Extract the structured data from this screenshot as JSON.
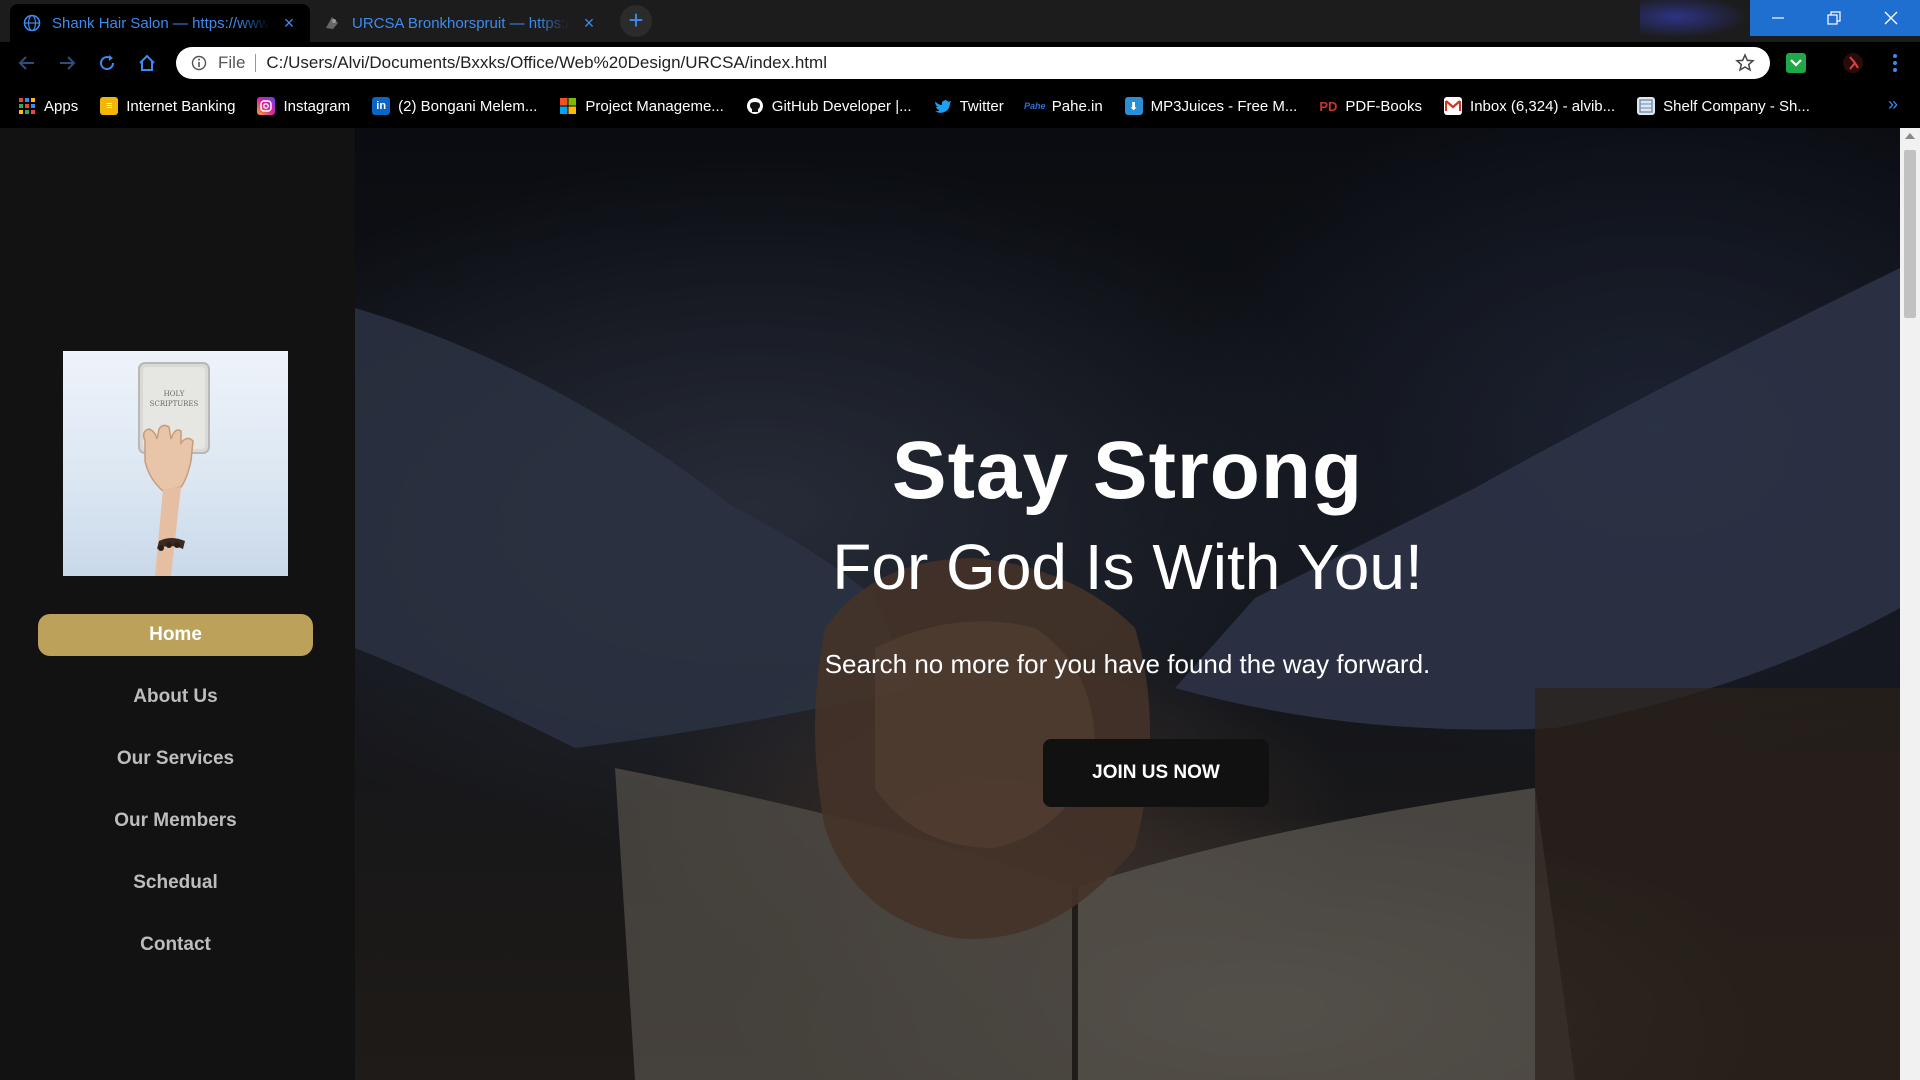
{
  "browser": {
    "tabs": [
      {
        "title": "Shank Hair Salon — https://www.shankhairsalon.co.za",
        "active": true
      },
      {
        "title": "URCSA Bronkhorspruit — https://",
        "active": false
      }
    ],
    "address": {
      "scheme": "File",
      "url": "C:/Users/Alvi/Documents/Bxxks/Office/Web%20Design/URCSA/index.html"
    },
    "bookmarks": [
      {
        "label": "Apps",
        "icon": "apps-grid-icon",
        "color": "#e8453c"
      },
      {
        "label": "Internet Banking",
        "icon": "bank-icon",
        "color": "#f2b705"
      },
      {
        "label": "Instagram",
        "icon": "instagram-icon",
        "color": "#d6249f"
      },
      {
        "label": "(2) Bongani Melem...",
        "icon": "linkedin-icon",
        "color": "#0a66c2"
      },
      {
        "label": "Project Manageme...",
        "icon": "microsoft-icon",
        "color": "#f25022"
      },
      {
        "label": "GitHub Developer |...",
        "icon": "github-icon",
        "color": "#333333"
      },
      {
        "label": "Twitter",
        "icon": "twitter-icon",
        "color": "#1da1f2"
      },
      {
        "label": "Pahe.in",
        "icon": "pahe-icon",
        "color": "#2f6fd6"
      },
      {
        "label": "MP3Juices - Free M...",
        "icon": "download-icon",
        "color": "#2b8fd6"
      },
      {
        "label": "PDF-Books",
        "icon": "pdf-icon",
        "color": "#c0392b"
      },
      {
        "label": "Inbox (6,324) - alvib...",
        "icon": "gmail-icon",
        "color": "#d93025"
      },
      {
        "label": "Shelf Company - Sh...",
        "icon": "shelf-icon",
        "color": "#6b8fb3"
      }
    ],
    "more_bookmarks": "»"
  },
  "site": {
    "menu": [
      {
        "label": "Home",
        "active": true
      },
      {
        "label": "About Us",
        "active": false
      },
      {
        "label": "Our Services",
        "active": false
      },
      {
        "label": "Our Members",
        "active": false
      },
      {
        "label": "Schedual",
        "active": false
      },
      {
        "label": "Contact",
        "active": false
      }
    ],
    "logo_alt": "hand-holding-bible-image",
    "bible_text": [
      "HOLY",
      "SCRIPTURES"
    ],
    "hero": {
      "title": "Stay Strong",
      "subtitle": "For God Is With You!",
      "text": "Search no more for you have found the way forward.",
      "button": "JOIN US NOW"
    },
    "colors": {
      "accent": "#bba15a",
      "sidebar": "#121212",
      "button": "#111111"
    }
  }
}
